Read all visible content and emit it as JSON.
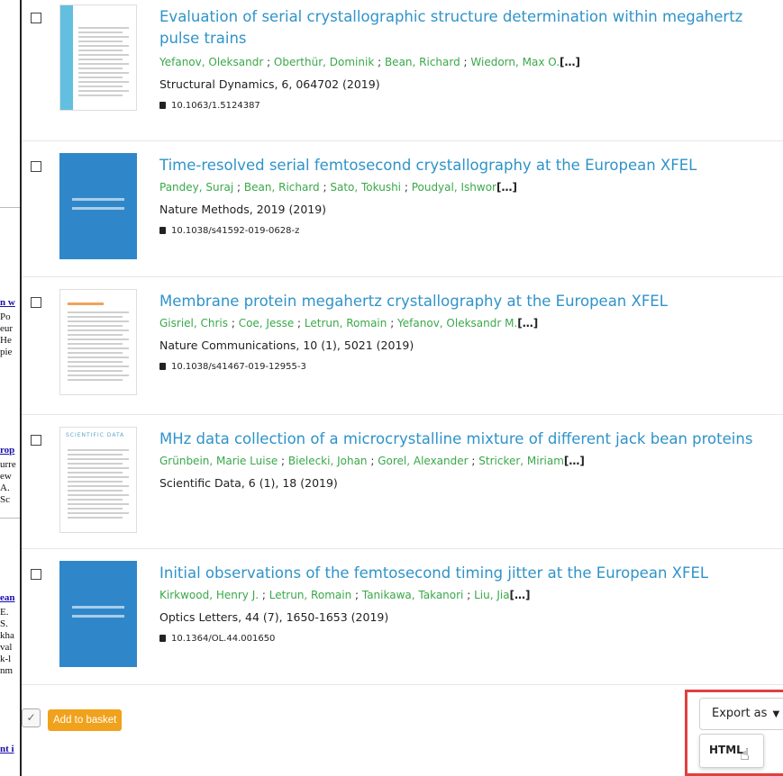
{
  "left_fragments": [
    {
      "text": "n w",
      "link": true
    },
    {
      "text": " Po",
      "link": false
    },
    {
      "text": "eur",
      "link": false
    },
    {
      "text": "He",
      "link": false
    },
    {
      "text": "pie",
      "link": false
    },
    {
      "text": "rop",
      "link": true
    },
    {
      "text": "urre",
      "link": false
    },
    {
      "text": "ew",
      "link": false
    },
    {
      "text": "A.",
      "link": false
    },
    {
      "text": " Sc",
      "link": false
    },
    {
      "text": "ean",
      "link": true
    },
    {
      "text": "E.",
      "link": false
    },
    {
      "text": " S.",
      "link": false
    },
    {
      "text": "kha",
      "link": false
    },
    {
      "text": "val",
      "link": false
    },
    {
      "text": "k-l",
      "link": false
    },
    {
      "text": "nm",
      "link": false
    },
    {
      "text": "nt i",
      "link": true
    }
  ],
  "results": [
    {
      "title": "Evaluation of serial crystallographic structure determination within megahertz pulse trains",
      "authors": [
        "Yefanov, Oleksandr",
        "Oberthür, Dominik",
        "Bean, Richard",
        "Wiedorn, Max O."
      ],
      "more": "[…]",
      "journal": "Structural Dynamics, 6, 064702 (2019)",
      "doi": "10.1063/1.5124387",
      "thumb": "page-side"
    },
    {
      "title": "Time-resolved serial femtosecond crystallography at the European XFEL",
      "authors": [
        "Pandey, Suraj",
        "Bean, Richard",
        "Sato, Tokushi",
        "Poudyal, Ishwor"
      ],
      "more": "[…]",
      "journal": "Nature Methods, 2019 (2019)",
      "doi": "10.1038/s41592-019-0628-z",
      "thumb": "blue"
    },
    {
      "title": "Membrane protein megahertz crystallography at the European XFEL",
      "authors": [
        "Gisriel, Chris",
        "Coe, Jesse",
        "Letrun, Romain",
        "Yefanov, Oleksandr M."
      ],
      "more": "[…]",
      "journal": "Nature Communications, 10 (1), 5021 (2019)",
      "doi": "10.1038/s41467-019-12955-3",
      "thumb": "page-orange"
    },
    {
      "title": "MHz data collection of a microcrystalline mixture of different jack bean proteins",
      "authors": [
        "Grünbein, Marie Luise",
        "Bielecki, Johan",
        "Gorel, Alexander",
        "Stricker, Miriam"
      ],
      "more": "[…]",
      "journal": "Scientific Data, 6 (1), 18 (2019)",
      "doi": "",
      "thumb": "page-sd",
      "thumb_title": "SCIENTIFIC DATA"
    },
    {
      "title": "Initial observations of the femtosecond timing jitter at the European XFEL",
      "authors": [
        "Kirkwood, Henry J.",
        "Letrun, Romain",
        "Tanikawa, Takanori",
        "Liu, Jia"
      ],
      "more": "[…]",
      "journal": "Optics Letters, 44 (7), 1650-1653 (2019)",
      "doi": "10.1364/OL.44.001650",
      "thumb": "blue"
    }
  ],
  "controls": {
    "add_to_basket": "Add to basket",
    "export_label": "Export as",
    "export_option": "HTML"
  },
  "colors": {
    "title": "#2f93c9",
    "authors": "#3aa84a",
    "basket": "#f0a21c",
    "highlight": "#e0403f"
  }
}
